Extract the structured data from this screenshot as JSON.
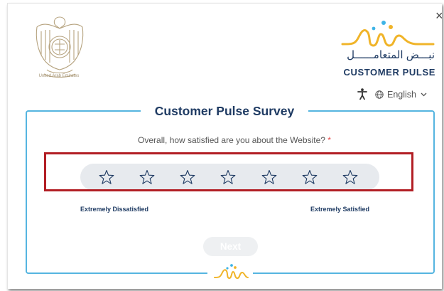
{
  "header": {
    "emblem_caption": "United Arab Emirates",
    "brand_arabic": "نبـــض المتعامــــــل",
    "brand_english": "CUSTOMER PULSE",
    "close_symbol": "×"
  },
  "toolbar": {
    "language": "English",
    "accessibility_icon": "accessibility-person-icon",
    "language_icon": "globe-icon"
  },
  "survey": {
    "title": "Customer Pulse Survey",
    "question": "Overall, how satisfied are you about the Website?",
    "required_marker": "*",
    "rating": {
      "max": 7,
      "selected": 0
    },
    "scale_low": "Extremely Dissatisfied",
    "scale_high": "Extremely Satisfied",
    "next_label": "Next"
  },
  "colors": {
    "navy": "#1f3b63",
    "panel_border": "#55b5e0",
    "highlight": "#b21e24",
    "gold": "#f0b429",
    "cyan": "#3fb4e6"
  }
}
